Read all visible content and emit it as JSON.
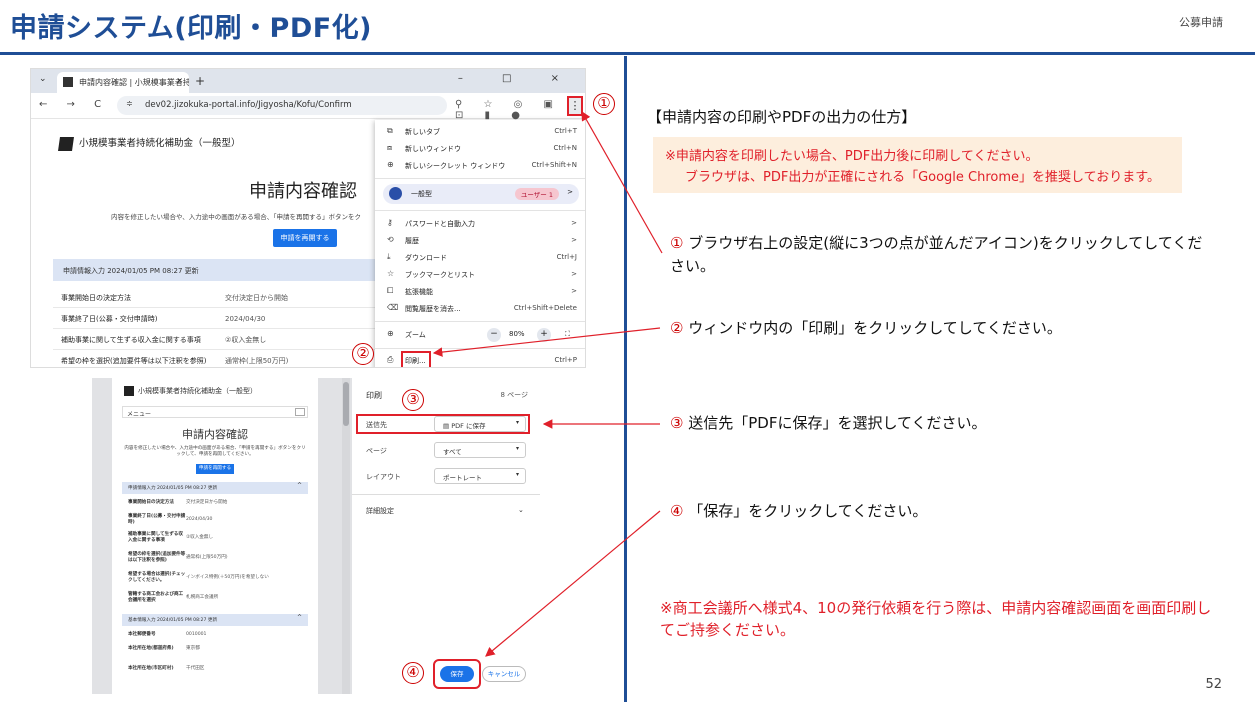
{
  "header": {
    "title": "申請システム(印刷・PDF化)",
    "category": "公募申請"
  },
  "page_number": "52",
  "markers": {
    "one": "①",
    "two": "②",
    "three": "③",
    "four": "④"
  },
  "browser": {
    "tab_title": "申請内容確認 | 小規模事業者持",
    "tab_close": "×",
    "new_tab": "+",
    "window_controls": "– □ ×",
    "nav_icons": "← → C ⌂",
    "url": "dev02.jizokuka-portal.info/Jigyosha/Kofu/Confirm",
    "toolbar_icons": "⚲ ☆ ◎ ▣ ⊡ ▮ ●",
    "kebab": "⋮"
  },
  "confirm_page": {
    "grant_name": "小規模事業者持続化補助金（一般型）",
    "title": "申請内容確認",
    "instruction": "内容を修正したい場合や、入力途中の画面がある場合、「申請を再開する」ボタンをク",
    "reopen_button": "申請を再開する",
    "section_band": "申請情報入力 2024/01/05 PM 08:27 更新",
    "rows": [
      {
        "label": "事業開始日の決定方法",
        "value": "交付決定日から開始"
      },
      {
        "label": "事業終了日(公募・交付申請時)",
        "value": "2024/04/30"
      },
      {
        "label": "補助事業に関して生ずる収入金に関する事項",
        "value": "②収入金無し"
      },
      {
        "label": "希望の枠を選択(追加要件等は以下注釈を参照)",
        "value": "通常枠(上限50万円)"
      }
    ]
  },
  "chrome_menu": {
    "items": [
      {
        "icon": "⧉",
        "label": "新しいタブ",
        "shortcut": "Ctrl+T"
      },
      {
        "icon": "⧈",
        "label": "新しいウィンドウ",
        "shortcut": "Ctrl+N"
      },
      {
        "icon": "⊕",
        "label": "新しいシークレット ウィンドウ",
        "shortcut": "Ctrl+Shift+N"
      }
    ],
    "profile": {
      "label": "一般型",
      "tag": "ユーザー 1",
      "arrow": ">"
    },
    "items2": [
      {
        "icon": "⚷",
        "label": "パスワードと自動入力",
        "shortcut": ">"
      },
      {
        "icon": "⟲",
        "label": "履歴",
        "shortcut": ">"
      },
      {
        "icon": "⤓",
        "label": "ダウンロード",
        "shortcut": "Ctrl+J"
      },
      {
        "icon": "☆",
        "label": "ブックマークとリスト",
        "shortcut": ">"
      },
      {
        "icon": "⧠",
        "label": "拡張機能",
        "shortcut": ">"
      },
      {
        "icon": "⌫",
        "label": "閲覧履歴を消去...",
        "shortcut": "Ctrl+Shift+Delete"
      }
    ],
    "zoom": {
      "icon": "⊕",
      "label": "ズーム",
      "minus": "−",
      "value": "80%",
      "plus": "+",
      "full": "⛶"
    },
    "print": {
      "icon": "⎙",
      "label": "印刷...",
      "shortcut": "Ctrl+P"
    }
  },
  "print_preview": {
    "grant_name": "小規模事業者持続化補助金（一般型）",
    "menu_label": "メニュー",
    "title": "申請内容確認",
    "instruction": "内容を修正したい場合や、入力途中の画面がある場合、「申請を再開する」ボタンをクリックして、申請を再開してください。",
    "reopen_button": "申請を再開する",
    "band1": "申請情報入力 2024/01/05 PM 08:27 更新",
    "rows1": [
      {
        "label": "事業開始日の決定方法",
        "value": "交付決定日から開始"
      },
      {
        "label": "事業終了日(公募・交付申請時)",
        "value": "2024/04/30"
      },
      {
        "label": "補助事業に関して生ずる収入金に関する事項",
        "value": "②収入金無し"
      },
      {
        "label": "希望の枠を選択(追加要件等は以下注釈を参照)",
        "value": "通常枠(上限50万円)"
      },
      {
        "label": "希望する場合は選択(チェックしてください。",
        "value": "インボイス特例(＋50万円)を希望しない"
      },
      {
        "label": "管轄する商工会および商工会議所を選択",
        "value": "札幌商工会議所"
      }
    ],
    "band2": "基本情報入力 2024/01/05 PM 08:27 更新",
    "rows2": [
      {
        "label": "本社郵便番号",
        "value": "0010001"
      },
      {
        "label": "本社所在地(都道府県)",
        "value": "東京都"
      },
      {
        "label": "本社所在地(市区町村)",
        "value": "千代田区"
      }
    ],
    "chevron": "^"
  },
  "print_settings": {
    "title": "印刷",
    "pages_count": "8 ページ",
    "destination_label": "送信先",
    "destination_value": "PDF に保存",
    "pages_label": "ページ",
    "pages_value": "すべて",
    "layout_label": "レイアウト",
    "layout_value": "ポートレート",
    "details_label": "詳細設定",
    "save_button": "保存",
    "cancel_button": "キャンセル",
    "dropdown_arrow": "▾"
  },
  "instructions": {
    "heading": "【申請内容の印刷やPDFの出力の仕方】",
    "note_line1": "※申請内容を印刷したい場合、PDF出力後に印刷してください。",
    "note_line2": "ブラウザは、PDF出力が正確にされる「Google Chrome」を推奨しております。",
    "steps": [
      {
        "num": "①",
        "text": "ブラウザ右上の設定(縦に3つの点が並んだアイコン)をクリックしてしてください。"
      },
      {
        "num": "②",
        "text": "ウィンドウ内の「印刷」をクリックしてしてください。"
      },
      {
        "num": "③",
        "text": "送信先「PDFに保存」を選択してください。"
      },
      {
        "num": "④",
        "text": "「保存」をクリックしてください。"
      }
    ],
    "footer_note": "※商工会議所へ様式4、10の発行依頼を行う際は、申請内容確認画面を画面印刷してご持参ください。"
  },
  "colors": {
    "brand": "#1f4e96",
    "alert": "#e0202a",
    "chrome_blue": "#1a73e8",
    "note_bg": "#fdeedd"
  }
}
